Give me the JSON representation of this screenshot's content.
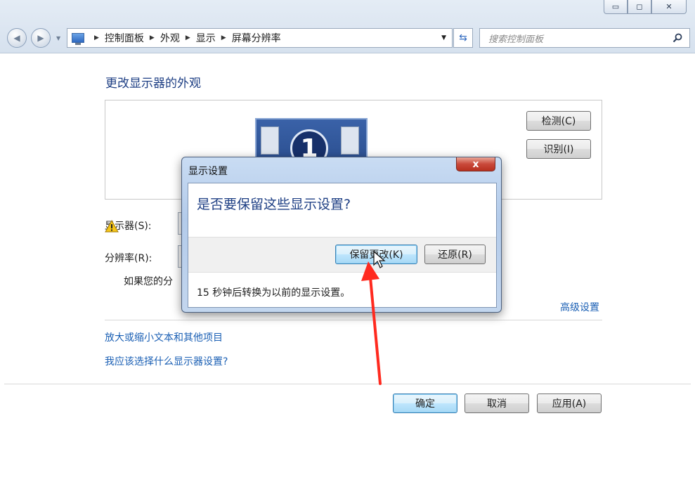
{
  "window": {
    "minimize_label": "▭",
    "maximize_label": "◻",
    "close_label": "✕"
  },
  "address_bar": {
    "breadcrumbs": [
      "控制面板",
      "外观",
      "显示",
      "屏幕分辨率"
    ]
  },
  "search": {
    "placeholder": "搜索控制面板"
  },
  "page": {
    "title": "更改显示器的外观",
    "monitor_number": "1",
    "detect_button": "检测(C)",
    "identify_button": "识别(I)",
    "display_label": "显示器(S):",
    "resolution_label": "分辨率(R):",
    "warning_text": "如果您的分",
    "advanced_link": "高级设置",
    "link_text_size": "放大或缩小文本和其他项目",
    "link_help": "我应该选择什么显示器设置?",
    "ok_button": "确定",
    "cancel_button": "取消",
    "apply_button": "应用(A)"
  },
  "dialog": {
    "title": "显示设置",
    "close_label": "x",
    "question": "是否要保留这些显示设置?",
    "keep_button": "保留更改(K)",
    "revert_button": "还原(R)",
    "status": "15 秒钟后转换为以前的显示设置。"
  },
  "colors": {
    "title_blue": "#1e3f84",
    "link_blue": "#1a5fb4",
    "annotation_red": "#ff2a1f"
  }
}
